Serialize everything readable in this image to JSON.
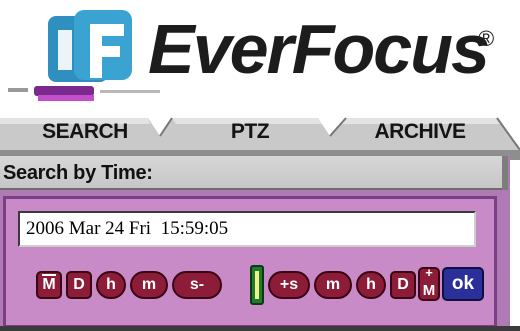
{
  "logo": {
    "brand": "EverFocus",
    "registered": "®",
    "mark_colors": {
      "blue": "#2f8fbf",
      "purple": "#7a2a8c",
      "text": "#1c1c1c"
    }
  },
  "tabs": [
    {
      "label": "SEARCH",
      "active": false
    },
    {
      "label": "PTZ",
      "active": false
    },
    {
      "label": "ARCHIVE",
      "active": false
    }
  ],
  "search": {
    "title": "Search by Time:",
    "datetime_value": "2006 Mar 24 Fri  15:59:05"
  },
  "controls": {
    "minus_month": "M",
    "minus_day": "D",
    "minus_hour": "h",
    "minus_minute": "m",
    "minus_second": "s-",
    "plus_second": "+s",
    "plus_minute": "m",
    "plus_hour": "h",
    "plus_day": "D",
    "plus_month_sign": "+",
    "plus_month": "M",
    "ok": "ok"
  },
  "colors": {
    "panel": "#b07ab4",
    "inner": "#c88bc8",
    "button": "#8c1c37",
    "ok": "#2b2f9a",
    "slider": "#1f7a2c"
  }
}
